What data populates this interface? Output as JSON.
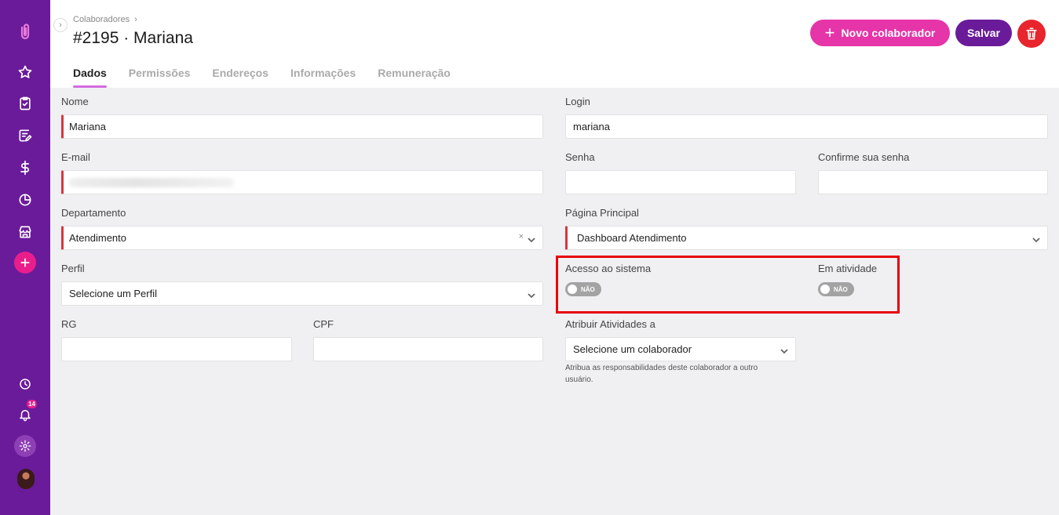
{
  "sidebar": {
    "items": [
      "logo-icon",
      "star-icon",
      "clipboard-check-icon",
      "edit-note-icon",
      "dollar-icon",
      "pie-chart-icon",
      "store-icon",
      "plus-icon",
      "clock-icon",
      "bell-icon",
      "gear-icon",
      "avatar"
    ],
    "notification_count": "14",
    "accent": "#6a1b9a"
  },
  "header": {
    "breadcrumb": "Colaboradores",
    "title": "#2195 · Mariana",
    "tabs": [
      {
        "label": "Dados",
        "active": true
      },
      {
        "label": "Permissões",
        "active": false
      },
      {
        "label": "Endereços",
        "active": false
      },
      {
        "label": "Informações",
        "active": false
      },
      {
        "label": "Remuneração",
        "active": false
      }
    ],
    "new_button": "Novo colaborador",
    "save_button": "Salvar"
  },
  "form": {
    "nome": {
      "label": "Nome",
      "value": "Mariana"
    },
    "login": {
      "label": "Login",
      "value": "mariana"
    },
    "email": {
      "label": "E-mail",
      "value": ""
    },
    "senha": {
      "label": "Senha",
      "value": ""
    },
    "confirme": {
      "label": "Confirme sua senha",
      "value": ""
    },
    "departamento": {
      "label": "Departamento",
      "value": "Atendimento",
      "clear": "×"
    },
    "pagina_principal": {
      "label": "Página Principal",
      "value": "Dashboard Atendimento"
    },
    "perfil": {
      "label": "Perfil",
      "value": "Selecione um Perfil"
    },
    "acesso": {
      "label": "Acesso ao sistema",
      "toggle": "NÃO"
    },
    "atividade": {
      "label": "Em atividade",
      "toggle": "NÃO"
    },
    "rg": {
      "label": "RG",
      "value": ""
    },
    "cpf": {
      "label": "CPF",
      "value": ""
    },
    "atribuir": {
      "label": "Atribuir Atividades a",
      "value": "Selecione um colaborador",
      "helper_1": "Atribua as responsabilidades deste colaborador a outro",
      "helper_2": "usuário."
    }
  },
  "colors": {
    "primary": "#6a1b9a",
    "pink": "#e535a8",
    "danger": "#e8242c",
    "highlight": "#e8000b"
  }
}
